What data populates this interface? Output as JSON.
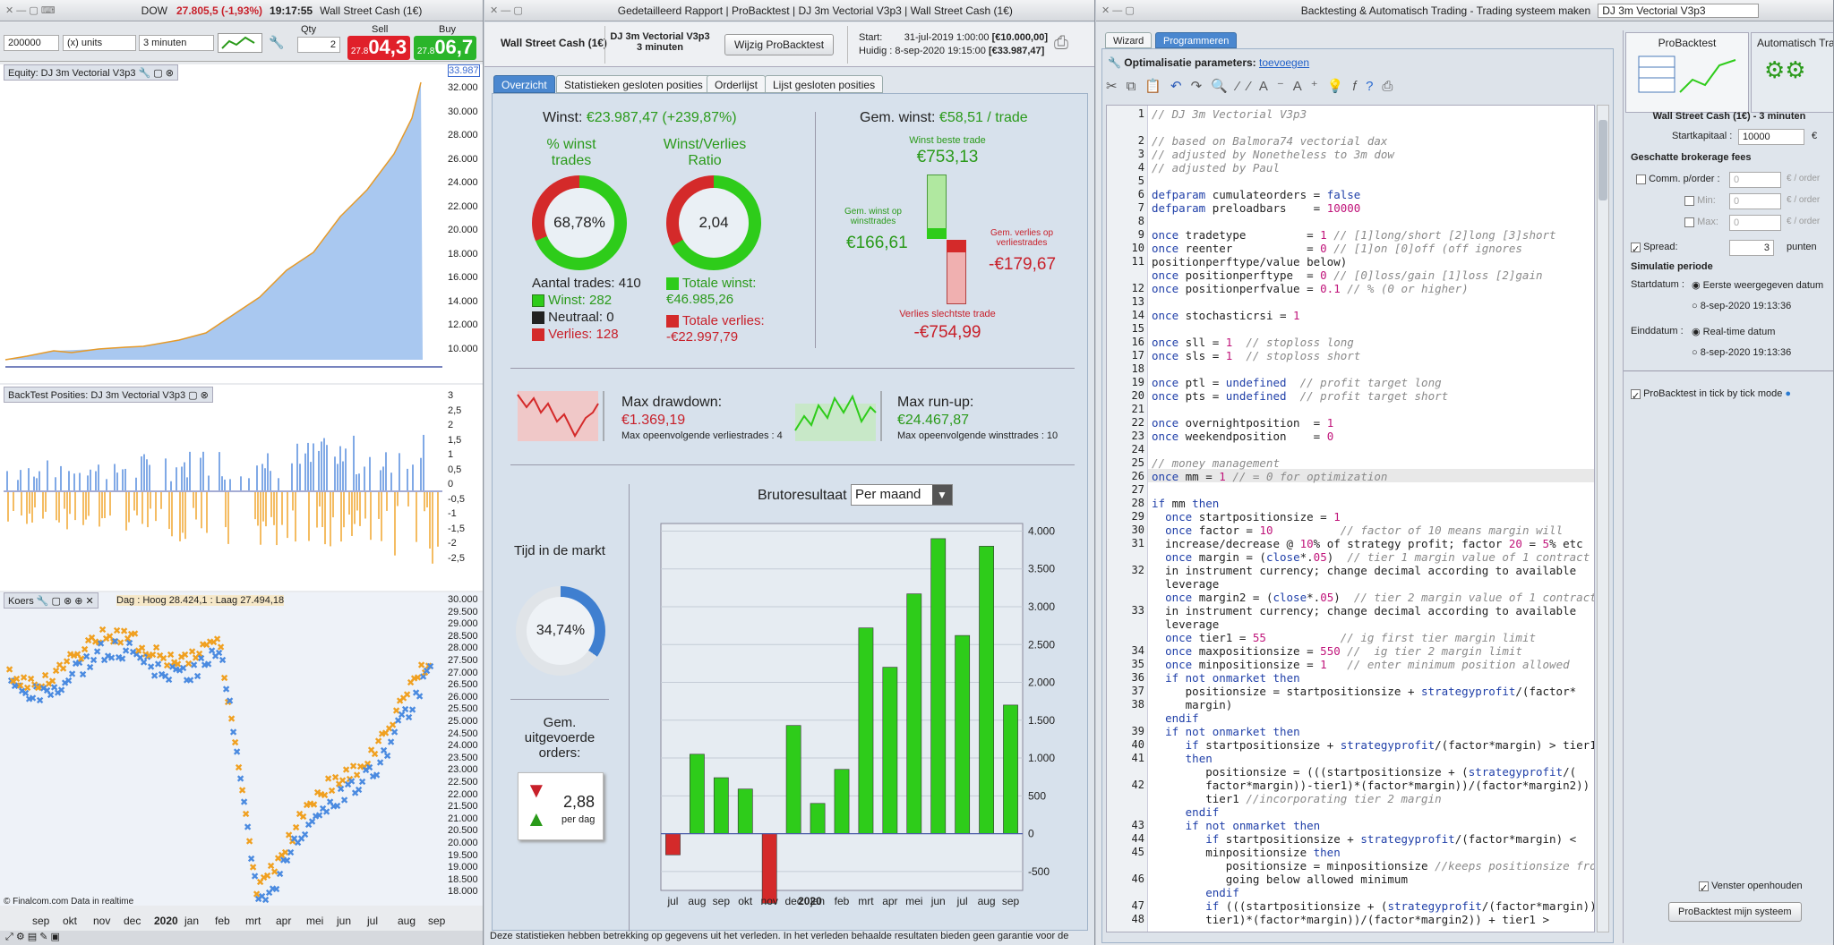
{
  "left": {
    "title_name": "DOW",
    "title_change": "27.805,5 (-1,93%)",
    "title_time": "19:17:55",
    "title_instr": "Wall Street Cash (1€)",
    "qty_value": "200000",
    "units": "(x) units",
    "interval": "3 minuten",
    "qty_label": "Qty",
    "qty": "2",
    "sell_label": "Sell",
    "sell_small": "27.8",
    "sell_big": "04,3",
    "buy_label": "Buy",
    "buy_small": "27.8",
    "buy_big": "06,7",
    "equity_title": "Equity: DJ 3m Vectorial V3p3",
    "equity_last": "33.987",
    "equity_ticks": [
      "32.000",
      "30.000",
      "28.000",
      "26.000",
      "24.000",
      "22.000",
      "20.000",
      "18.000",
      "16.000",
      "14.000",
      "12.000",
      "10.000"
    ],
    "pos_title": "BackTest Posities: DJ 3m Vectorial V3p3",
    "pos_ticks": [
      "3",
      "2,5",
      "2",
      "1,5",
      "1",
      "0,5",
      "0",
      "-0,5",
      "-1",
      "-1,5",
      "-2",
      "-2,5"
    ],
    "koers_title": "Koers",
    "koers_legend": "Dag : Hoog 28.424,1 : Laag 27.494,18",
    "koers_ticks": [
      "30.000",
      "29.500",
      "29.000",
      "28.500",
      "28.000",
      "27.500",
      "27.000",
      "26.500",
      "26.000",
      "25.500",
      "25.000",
      "24.500",
      "24.000",
      "23.500",
      "23.000",
      "22.500",
      "22.000",
      "21.500",
      "21.000",
      "20.500",
      "20.000",
      "19.500",
      "19.000",
      "18.500",
      "18.000"
    ],
    "x_months": [
      "sep",
      "okt",
      "nov",
      "dec",
      "2020",
      "jan",
      "feb",
      "mrt",
      "apr",
      "mei",
      "jun",
      "jul",
      "aug",
      "sep"
    ],
    "credit": "© Finalcom.com Data in realtime"
  },
  "mid": {
    "title_items": [
      "Gedetailleerd Rapport",
      "ProBacktest",
      "DJ 3m Vectorial V3p3",
      "Wall Street Cash (1€)"
    ],
    "instrument": "Wall Street Cash (1€)",
    "system": "DJ 3m Vectorial V3p3",
    "system_tf": "3 minuten",
    "edit_btn": "Wijzig ProBacktest",
    "start_label": "Start:",
    "start_date": "31-jul-2019 1:00:00",
    "start_value": "[€10.000,00]",
    "now_label": "Huidig :",
    "now_date": "8-sep-2020 19:15:00",
    "now_value": "[€33.987,47]",
    "tabs": [
      "Overzicht",
      "Statistieken gesloten posities",
      "Orderlijst",
      "Lijst gesloten posities"
    ],
    "winst_label": "Winst:",
    "winst_value": "€23.987,47 (+239,87%)",
    "pct_label": "% winst trades",
    "pct_value": "68,78%",
    "ratio_label": "Winst/Verlies Ratio",
    "ratio_value": "2,04",
    "n_trades": "Aantal trades: 410",
    "winst_trades": "Winst: 282",
    "neutraal": "Neutraal: 0",
    "verlies_trades": "Verlies: 128",
    "totale_winst_label": "Totale winst:",
    "totale_winst": "€46.985,26",
    "totale_verlies_label": "Totale verlies:",
    "totale_verlies": "-€22.997,79",
    "gem_label": "Gem. winst:",
    "gem_value": "€58,51 / trade",
    "best_label": "Winst beste trade",
    "best_value": "€753,13",
    "gemw_label": "Gem. winst op winsttrades",
    "gemw_value": "€166,61",
    "gemv_label": "Gem. verlies op verliestrades",
    "gemv_value": "-€179,67",
    "worst_label": "Verlies slechtste trade",
    "worst_value": "-€754,99",
    "dd_label": "Max drawdown:",
    "dd_value": "€1.369,19",
    "dd_sub": "Max opeenvolgende verliestrades : 4",
    "ru_label": "Max run-up:",
    "ru_value": "€24.467,87",
    "ru_sub": "Max opeenvolgende winsttrades : 10",
    "tijd_label": "Tijd in de markt",
    "tijd_value": "34,74%",
    "orders_label": "Gem. uitgevoerde orders:",
    "orders_value": "2,88",
    "orders_unit": "per dag",
    "bruto_label": "Brutoresultaat",
    "bruto_select": "Per maand",
    "footer": "Deze statistieken hebben betrekking op gegevens uit het verleden. In het verleden behaalde resultaten bieden geen garantie voor de"
  },
  "chart_data": {
    "type": "bar",
    "title": "Brutoresultaat",
    "categories": [
      "jul",
      "aug",
      "sep",
      "okt",
      "nov",
      "dec",
      "jan",
      "feb",
      "mrt",
      "apr",
      "mei",
      "jun",
      "jul",
      "aug",
      "sep"
    ],
    "category_group_label": "2020",
    "values": [
      -280,
      1050,
      740,
      590,
      -920,
      1430,
      400,
      850,
      2720,
      2200,
      3170,
      3900,
      2620,
      3800,
      1700
    ],
    "ylim": [
      -750,
      4100
    ],
    "yticks": [
      4000,
      3500,
      3000,
      2500,
      2000,
      1500,
      1000,
      500,
      0,
      -500
    ],
    "ytick_labels": [
      "4.000",
      "3.500",
      "3.000",
      "2.500",
      "2.000",
      "1.500",
      "1.000",
      "500",
      "0",
      "-500"
    ],
    "colors": {
      "positive": "#2ecc1a",
      "negative": "#d42a2a"
    }
  },
  "right": {
    "title": "Backtesting & Automatisch Trading - Trading systeem maken",
    "title_field": "DJ 3m Vectorial V3p3",
    "tab_wizard": "Wizard",
    "tab_prog": "Programmeren",
    "opt_label": "Optimalisatie parameters:",
    "opt_link": "toevoegen",
    "code": [
      "// DJ 3m Vectorial V3p3",
      "",
      "// based on Balmora74 vectorial dax",
      "// adjusted by Nonetheless to 3m dow",
      "// adjusted by Paul",
      "",
      "defparam cumulateorders = false",
      "defparam preloadbars    = 10000",
      "",
      "once tradetype         = 1 // [1]long/short [2]long [3]short",
      "once reenter           = 0 // [1]on [0]off (off ignores",
      "positionperftype/value below)",
      "once positionperftype  = 0 // [0]loss/gain [1]loss [2]gain",
      "once positionperfvalue = 0.1 // % (0 or higher)",
      "",
      "once stochasticrsi = 1",
      "",
      "once sll = 1  // stoploss long",
      "once sls = 1  // stoploss short",
      "",
      "once ptl = undefined  // profit target long",
      "once pts = undefined  // profit target short",
      "",
      "once overnightposition  = 1",
      "once weekendposition    = 0",
      "",
      "// money management",
      "once mm = 1 // = 0 for optimization",
      "",
      "if mm then",
      "  once startpositionsize = 1",
      "  once factor = 10          // factor of 10 means margin will",
      "  increase/decrease @ 10% of strategy profit; factor 20 = 5% etc",
      "  once margin = (close*.05)  // tier 1 margin value of 1 contract",
      "  in instrument currency; change decimal according to available",
      "  leverage",
      "  once margin2 = (close*.05)  // tier 2 margin value of 1 contract",
      "  in instrument currency; change decimal according to available",
      "  leverage",
      "  once tier1 = 55           // ig first tier margin limit",
      "  once maxpositionsize = 550 //  ig tier 2 margin limit",
      "  once minpositionsize = 1   // enter minimum position allowed",
      "  if not onmarket then",
      "     positionsize = startpositionsize + strategyprofit/(factor*",
      "     margin)",
      "  endif",
      "  if not onmarket then",
      "     if startpositionsize + strategyprofit/(factor*margin) > tier1",
      "     then",
      "        positionsize = (((startpositionsize + (strategyprofit/(",
      "        factor*margin))-tier1)*(factor*margin))/(factor*margin2)) +",
      "        tier1 //incorporating tier 2 margin",
      "     endif",
      "     if not onmarket then",
      "        if startpositionsize + strategyprofit/(factor*margin) <",
      "        minpositionsize then",
      "           positionsize = minpositionsize //keeps positionsize from",
      "           going below allowed minimum",
      "        endif",
      "        if (((startpositionsize + (strategyprofit/(factor*margin))-",
      "        tier1)*(factor*margin))/(factor*margin2)) + tier1 >"
    ],
    "line_numbers": [
      "1",
      "",
      "2",
      "3",
      "4",
      "5",
      "6",
      "7",
      "8",
      "9",
      "10",
      "11",
      "",
      "12",
      "13",
      "14",
      "15",
      "16",
      "17",
      "18",
      "19",
      "20",
      "21",
      "22",
      "23",
      "24",
      "25",
      "26",
      "27",
      "28",
      "29",
      "30",
      "31",
      "",
      "32",
      "",
      "",
      "33",
      "",
      "",
      "34",
      "35",
      "36",
      "37",
      "38",
      "",
      "39",
      "40",
      "41",
      "",
      "42",
      "",
      "",
      "43",
      "44",
      "45",
      "",
      "46",
      "",
      "47",
      "48",
      ""
    ],
    "pb_tab": "ProBacktest",
    "auto_tab": "Automatisch Tra",
    "instr": "Wall Street Cash (1€) - 3 minuten",
    "kapitaal_label": "Startkapitaal :",
    "kapitaal": "10000",
    "cur": "€",
    "fees_label": "Geschatte brokerage fees",
    "comm_label": "Comm. p/order :",
    "min_label": "Min:",
    "max_label": "Max:",
    "zero": "0",
    "per_order": "€ / order",
    "spread_label": "Spread:",
    "spread": "3",
    "punten": "punten",
    "sim_label": "Simulatie periode",
    "start_label": "Startdatum :",
    "start_opt1": "Eerste weergegeven datum",
    "start_opt2": "8-sep-2020 19:13:36",
    "end_label": "Einddatum :",
    "end_opt1": "Real-time datum",
    "end_opt2": "8-sep-2020 19:13:36",
    "tick_label": "ProBacktest in tick by tick mode",
    "venster_label": "Venster openhouden",
    "run_btn": "ProBacktest mijn systeem"
  }
}
